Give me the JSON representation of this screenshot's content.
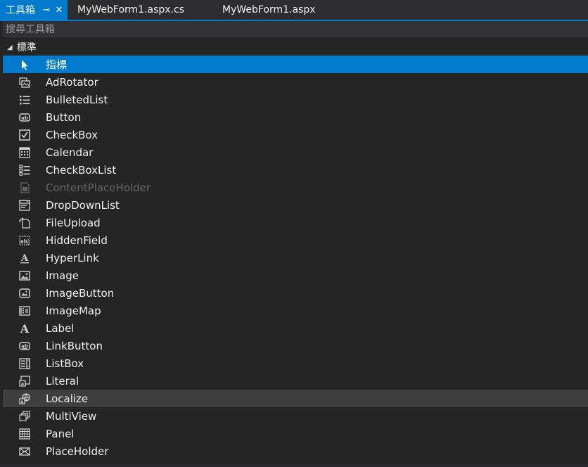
{
  "tabs": {
    "toolbox_title": "工具箱",
    "pin_icon": "⊸",
    "close_icon": "✕",
    "doc1": "MyWebForm1.aspx.cs",
    "doc2": "MyWebForm1.aspx"
  },
  "search": {
    "placeholder": "搜尋工具箱"
  },
  "group": {
    "caret": "◢",
    "label": "標準"
  },
  "items": [
    {
      "label": "指標",
      "icon": "pointer-icon"
    },
    {
      "label": "AdRotator",
      "icon": "adrotator-icon"
    },
    {
      "label": "BulletedList",
      "icon": "bulleted-list-icon"
    },
    {
      "label": "Button",
      "icon": "button-icon"
    },
    {
      "label": "CheckBox",
      "icon": "checkbox-icon"
    },
    {
      "label": "Calendar",
      "icon": "calendar-icon"
    },
    {
      "label": "CheckBoxList",
      "icon": "checkbox-list-icon"
    },
    {
      "label": "ContentPlaceHolder",
      "icon": "content-placeholder-icon"
    },
    {
      "label": "DropDownList",
      "icon": "dropdown-list-icon"
    },
    {
      "label": "FileUpload",
      "icon": "file-upload-icon"
    },
    {
      "label": "HiddenField",
      "icon": "hidden-field-icon"
    },
    {
      "label": "HyperLink",
      "icon": "hyperlink-icon"
    },
    {
      "label": "Image",
      "icon": "image-icon"
    },
    {
      "label": "ImageButton",
      "icon": "image-button-icon"
    },
    {
      "label": "ImageMap",
      "icon": "image-map-icon"
    },
    {
      "label": "Label",
      "icon": "label-icon"
    },
    {
      "label": "LinkButton",
      "icon": "link-button-icon"
    },
    {
      "label": "ListBox",
      "icon": "listbox-icon"
    },
    {
      "label": "Literal",
      "icon": "literal-icon"
    },
    {
      "label": "Localize",
      "icon": "localize-icon"
    },
    {
      "label": "MultiView",
      "icon": "multiview-icon"
    },
    {
      "label": "Panel",
      "icon": "panel-icon"
    },
    {
      "label": "PlaceHolder",
      "icon": "placeholder-icon"
    }
  ],
  "state": {
    "selected_index": 0,
    "hover_index": 19,
    "disabled_index": 7
  },
  "colors": {
    "accent": "#007acc",
    "background": "#252526",
    "text": "#f1f1f1",
    "disabled": "#656565"
  }
}
